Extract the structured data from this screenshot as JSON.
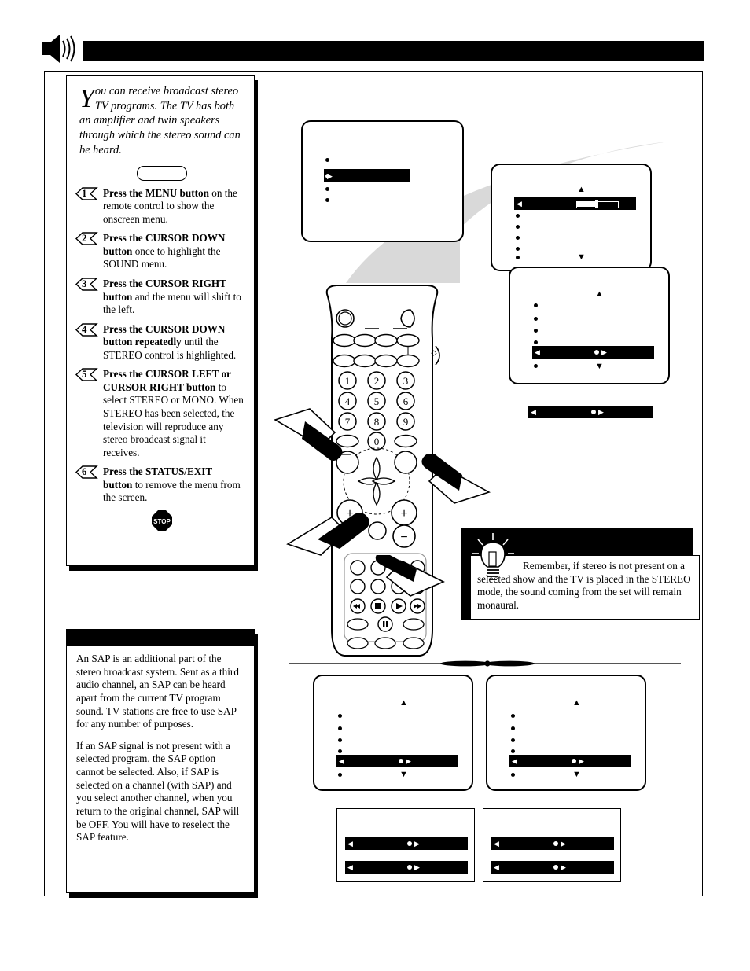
{
  "header": {
    "icon": "speaker-sound-icon",
    "title_bar_text": "",
    "title_bar_color": "#000000"
  },
  "instructions": {
    "intro_dropcap": "Y",
    "intro_text": "ou can receive broadcast stereo TV programs.  The TV has both an amplifier and twin speakers through which the stereo sound can be heard.",
    "steps": [
      {
        "number": "1",
        "bold_lead": "Press the MENU button",
        "rest": " on the remote control to show the onscreen menu."
      },
      {
        "number": "2",
        "bold_lead": "Press the CURSOR DOWN button",
        "rest": " once to highlight the SOUND menu."
      },
      {
        "number": "3",
        "bold_lead": "Press the CURSOR RIGHT button",
        "rest": " and the menu will shift to the left."
      },
      {
        "number": "4",
        "bold_lead": "Press the CURSOR DOWN button repeatedly",
        "rest": " until the STEREO control is highlighted."
      },
      {
        "number": "5",
        "bold_lead": "Press the CURSOR LEFT or CURSOR RIGHT button",
        "rest": " to select STEREO or MONO.  When STEREO has been selected, the television will reproduce any stereo broadcast signal it receives."
      },
      {
        "number": "6",
        "bold_lead": "Press the STATUS/EXIT button",
        "rest": " to remove the menu from the screen."
      }
    ],
    "stop_label": "STOP"
  },
  "sap_note": {
    "header_text": "",
    "paragraphs": [
      "An SAP is an additional part of the stereo broadcast system.  Sent as a third audio channel, an SAP can be heard apart from the current TV program sound.  TV stations are free to use SAP for any number of purposes.",
      "If an SAP signal is not present with a selected program, the SAP option cannot be selected.  Also, if SAP is selected on a channel (with SAP) and you select another channel, when you return to the original channel, SAP will be OFF.  You will have to reselect the SAP feature."
    ]
  },
  "tip": {
    "icon": "lightbulb-icon",
    "text": "Remember, if stereo is not present on a selected show and the TV is placed in the STEREO mode, the sound coming from the set will remain monaural."
  },
  "remote": {
    "keypad": [
      "1",
      "2",
      "3",
      "4",
      "5",
      "6",
      "7",
      "8",
      "9",
      "0"
    ],
    "plus_left": "+",
    "plus_right": "+",
    "minus": "−",
    "transport": [
      "rewind-icon",
      "stop-icon",
      "play-icon",
      "fast-forward-icon",
      "pause-icon"
    ]
  },
  "screens": {
    "main_menu": {
      "name": "onscreen-main-menu",
      "bullets": 4,
      "highlight_row": 2,
      "cursor": "cursor-right-indicator"
    },
    "sound_menu_slider": {
      "name": "onscreen-sound-menu",
      "bullets": 6,
      "highlight_row": 1,
      "has_slider": true,
      "up_arrow": "▲",
      "down_arrow": "▼"
    },
    "stereo_control": {
      "name": "onscreen-stereo-control",
      "bullets": 6,
      "highlight_row": 5,
      "left_arrow": "◀",
      "right_arrow": "▶",
      "up_arrow": "▲",
      "down_arrow": "▼"
    },
    "bottom_left": {
      "name": "onscreen-stereo-variant-left",
      "bullets": 6,
      "highlight_row": 5
    },
    "bottom_right": {
      "name": "onscreen-stereo-variant-right",
      "bullets": 6,
      "highlight_row": 5
    },
    "bar_box_left": {
      "name": "option-bars-left",
      "bars": 2
    },
    "bar_box_right": {
      "name": "option-bars-right",
      "bars": 2
    },
    "detached_bar": {
      "name": "detached-option-bar"
    }
  },
  "colors": {
    "ink": "#000000",
    "paper": "#ffffff",
    "beam": "#d9d9d9",
    "rule": "#555555"
  }
}
